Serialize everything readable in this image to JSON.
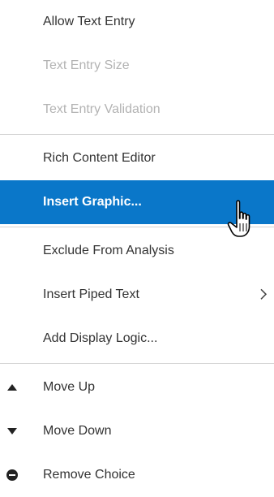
{
  "menu": {
    "items": [
      {
        "label": "Allow Text Entry"
      },
      {
        "label": "Text Entry Size"
      },
      {
        "label": "Text Entry Validation"
      },
      {
        "label": "Rich Content Editor"
      },
      {
        "label": "Insert Graphic..."
      },
      {
        "label": "Exclude From Analysis"
      },
      {
        "label": "Insert Piped Text"
      },
      {
        "label": "Add Display Logic..."
      },
      {
        "label": "Move Up"
      },
      {
        "label": "Move Down"
      },
      {
        "label": "Remove Choice"
      }
    ]
  },
  "icons": {
    "submenu": "chevron-right-icon",
    "move_up": "triangle-up-icon",
    "move_down": "triangle-down-icon",
    "remove": "minus-circle-icon",
    "cursor": "hand-pointer-icon"
  },
  "colors": {
    "selected_background": "#0a77c9",
    "text": "#333333",
    "disabled_text": "#b3b3b3",
    "divider": "#d2d2d2"
  }
}
